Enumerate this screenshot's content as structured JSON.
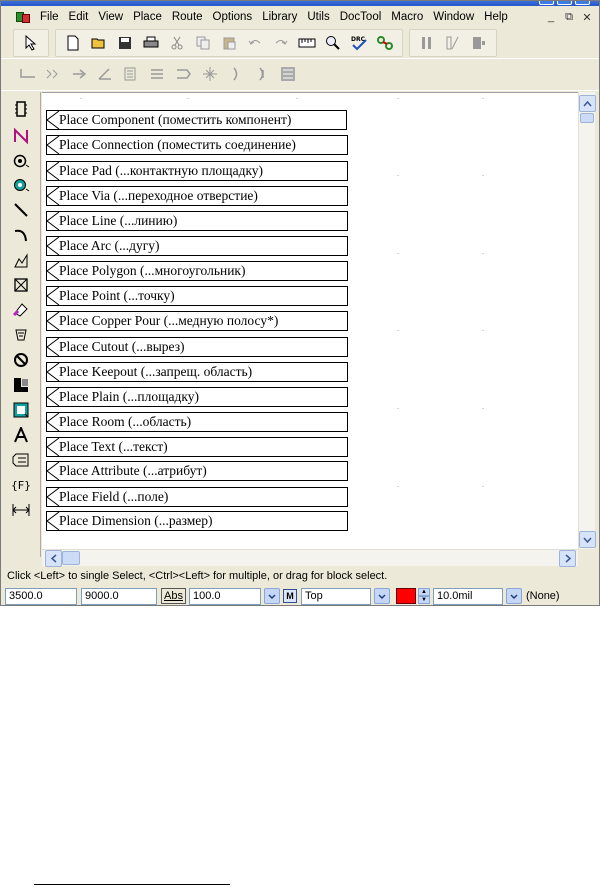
{
  "menu": {
    "items": [
      "File",
      "Edit",
      "View",
      "Place",
      "Route",
      "Options",
      "Library",
      "Utils",
      "DocTool",
      "Macro",
      "Window",
      "Help"
    ],
    "window_controls": [
      "_",
      "⧉",
      "✕"
    ]
  },
  "toolbar1": {
    "icons": [
      "select-arrow-icon",
      "new-document-icon",
      "open-folder-icon",
      "save-icon",
      "print-icon",
      "cut-icon",
      "copy-icon",
      "paste-icon",
      "undo-icon",
      "redo-icon",
      "measure-icon",
      "zoom-icon",
      "drc-icon",
      "highlight-net-icon",
      "column-icon",
      "two-columns-icon",
      "layer-icon"
    ]
  },
  "toolbar2": {
    "icons": [
      "route-manual-icon",
      "route-miter-icon",
      "route-push-icon",
      "route-angle-icon",
      "route-copy-icon",
      "route-bus-icon",
      "route-flip-icon",
      "route-swap-icon",
      "route-gloss-icon",
      "route-spread-icon",
      "route-fanout-icon"
    ]
  },
  "palette": [
    {
      "icon": "component-icon",
      "glyph": "▯"
    },
    {
      "icon": "connection-icon",
      "glyph": "ʌ"
    },
    {
      "icon": "pad-icon",
      "glyph": "⊙"
    },
    {
      "icon": "via-icon",
      "glyph": "⊚"
    },
    {
      "icon": "line-icon",
      "glyph": "╲"
    },
    {
      "icon": "arc-icon",
      "glyph": "⌒"
    },
    {
      "icon": "polygon-icon",
      "glyph": "⊿"
    },
    {
      "icon": "point-icon",
      "glyph": "⊠"
    },
    {
      "icon": "copper-pour-icon",
      "glyph": "⬙"
    },
    {
      "icon": "cutout-icon",
      "glyph": "⧉"
    },
    {
      "icon": "keepout-icon",
      "glyph": "⊘"
    },
    {
      "icon": "plain-icon",
      "glyph": "▙"
    },
    {
      "icon": "room-icon",
      "glyph": "▣"
    },
    {
      "icon": "text-icon",
      "glyph": "A"
    },
    {
      "icon": "attribute-icon",
      "glyph": "⊟"
    },
    {
      "icon": "field-icon",
      "glyph": "{F}"
    },
    {
      "icon": "dimension-icon",
      "glyph": "⊢⊣"
    }
  ],
  "callouts": [
    "Place Component (поместить компонент)",
    "Place Connection (поместить соединение)",
    "Place Pad (...контактную площадку)",
    "Place Via (...переходное отверстие)",
    "Place Line (...линию)",
    "Place Arc (...дугу)",
    "Place Polygon (...многоугольник)",
    "Place Point (...точку)",
    "Place Copper Pour (...медную полосу*)",
    "Place Cutout (...вырез)",
    "Place Keepout (...запрещ. область)",
    "Place Plain (...площадку)",
    "Place Room (...область)",
    "Place Text (...текст)",
    "Place Attribute (...атрибут)",
    "Place Field (...поле)",
    "Place Dimension (...размер)"
  ],
  "status": {
    "hint": "Click <Left> to single Select, <Ctrl><Left> for multiple, or drag for block select.",
    "x": "3500.0",
    "y": "9000.0",
    "abs_label": "Abs",
    "zoom": "100.0",
    "m_label": "M",
    "layer": "Top",
    "layer_color": "#ff0000",
    "width": "10.0mil",
    "net": "(None)"
  },
  "colors": {
    "chrome": "#ece9d8",
    "scroll_accent": "#c5d6f6",
    "title_blue": "#2456c8"
  }
}
